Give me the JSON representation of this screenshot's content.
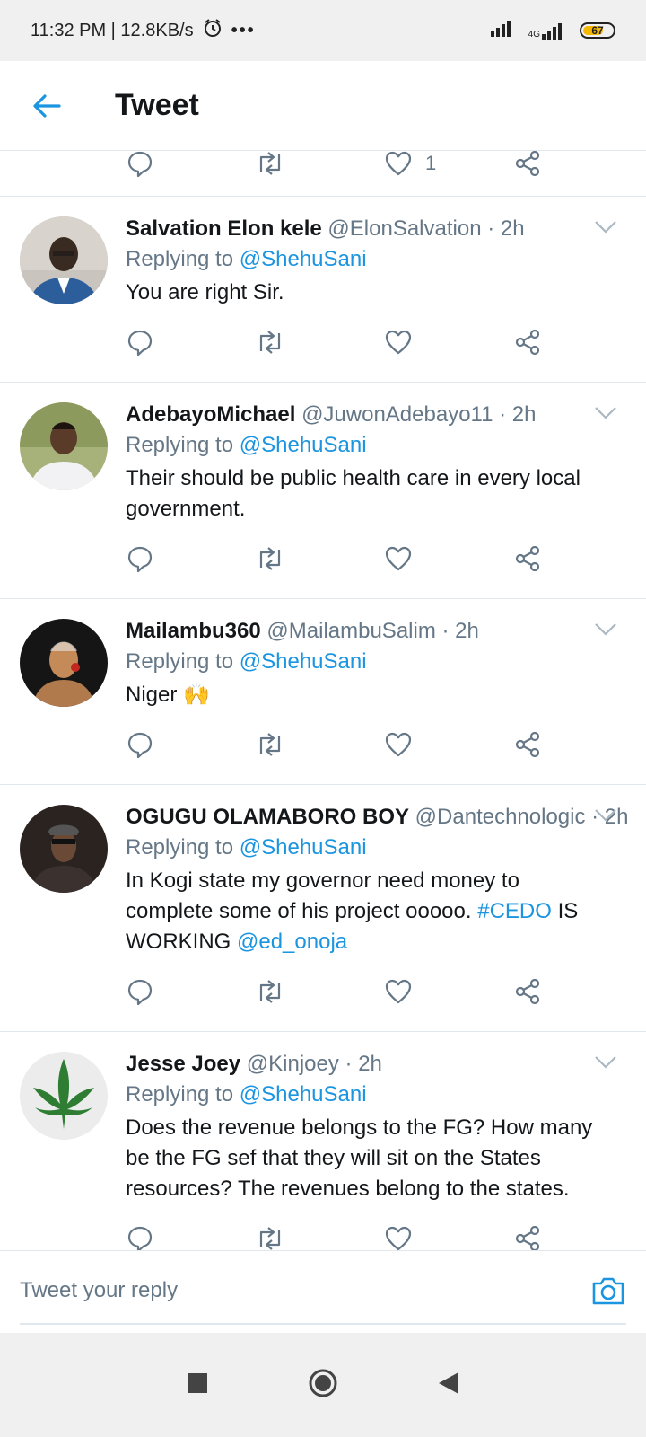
{
  "status_bar": {
    "time_speed": "11:32 PM | 12.8KB/s",
    "more": "•••",
    "network_label": "4G",
    "battery": "67"
  },
  "header": {
    "title": "Tweet"
  },
  "top_actions": {
    "like_count": "1"
  },
  "tweets": [
    {
      "name": "Salvation Elon kele",
      "meta": "@ElonSalvation · 2h",
      "replying_label": "Replying to",
      "replying_to": "@ShehuSani",
      "text": "You are right Sir."
    },
    {
      "name": "AdebayoMichael",
      "meta": "@JuwonAdebayo11 · 2h",
      "replying_label": "Replying to",
      "replying_to": "@ShehuSani",
      "text": "Their should be public health care in every local government."
    },
    {
      "name": "Mailambu360",
      "meta": "@MailambuSalim · 2h",
      "replying_label": "Replying to",
      "replying_to": "@ShehuSani",
      "text": "Niger 🙌"
    },
    {
      "name": "OGUGU OLAMABORO BOY",
      "meta": "@Dantechnologic · 2h",
      "replying_label": "Replying to",
      "replying_to": "@ShehuSani",
      "text_part1": "In Kogi state my governor need money to complete some of his project ooooo. ",
      "hashtag": "#CEDO",
      "text_part2": " IS WORKING ",
      "text_mention": "@ed_onoja"
    },
    {
      "name": "Jesse Joey",
      "meta": "@Kinjoey · 2h",
      "replying_label": "Replying to",
      "replying_to": "@ShehuSani",
      "text": "Does the revenue belongs to the FG? How many be the FG sef that they will sit on the States resources? The revenues belong to the states."
    }
  ],
  "reply_bar": {
    "placeholder": "Tweet your reply"
  },
  "colors": {
    "accent": "#1b95e0",
    "text": "#14171a",
    "secondary": "#657786",
    "divider": "#e1e8ed"
  },
  "icons": [
    "back-arrow-icon",
    "reply-icon",
    "retweet-icon",
    "like-icon",
    "share-icon",
    "chevron-down-icon",
    "camera-icon",
    "alarm-icon",
    "signal-icon",
    "battery-icon",
    "nav-square-icon",
    "nav-home-icon",
    "nav-back-icon"
  ]
}
